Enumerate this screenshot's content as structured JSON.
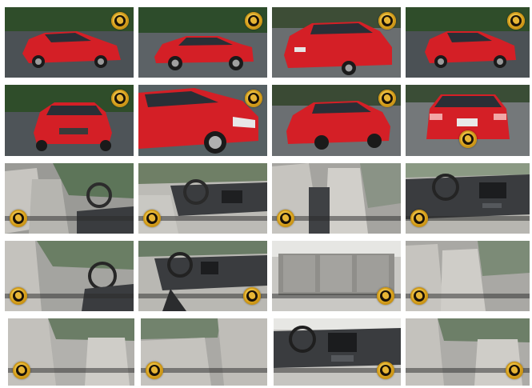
{
  "gallery": {
    "tiles": [
      {
        "view": "exterior-front-three-quarter",
        "watermark_position": "top-right"
      },
      {
        "view": "exterior-side",
        "watermark_position": "top-right"
      },
      {
        "view": "exterior-rear-three-quarter",
        "watermark_position": "top-right"
      },
      {
        "view": "exterior-front-three-quarter",
        "watermark_position": "top-right"
      },
      {
        "view": "exterior-front",
        "watermark_position": "top-right"
      },
      {
        "view": "exterior-side-closeup",
        "watermark_position": "top-right"
      },
      {
        "view": "exterior-rear-three-quarter",
        "watermark_position": "top-right"
      },
      {
        "view": "exterior-rear",
        "watermark_position": "bottom-center"
      },
      {
        "view": "interior-front-seats-driver-door",
        "watermark_position": "bottom-left"
      },
      {
        "view": "interior-dashboard-steering",
        "watermark_position": "bottom-left"
      },
      {
        "view": "interior-front-seats-passenger",
        "watermark_position": "bottom-left"
      },
      {
        "view": "interior-dashboard-center-console",
        "watermark_position": "bottom-left"
      },
      {
        "view": "interior-front-seat-steering",
        "watermark_position": "bottom-left"
      },
      {
        "view": "interior-dashboard-gear-shift",
        "watermark_position": "bottom-right"
      },
      {
        "view": "interior-rear-seats",
        "watermark_position": "bottom-right"
      },
      {
        "view": "interior-front-seats-window",
        "watermark_position": "bottom-left"
      },
      {
        "view": "interior-rear-seat-door",
        "watermark_position": "bottom-left"
      },
      {
        "view": "interior-rear-seat-legroom",
        "watermark_position": "bottom-left"
      },
      {
        "view": "interior-dashboard-rear-view",
        "watermark_position": "bottom-right"
      },
      {
        "view": "interior-rear-seats-side",
        "watermark_position": "bottom-right"
      }
    ]
  },
  "colors": {
    "car_body": "#d41f26",
    "interior": "#bdbcb8",
    "dashboard": "#3a3c3f",
    "watermark_gold": "#d9a21d"
  },
  "watermark": {
    "icon": "gold-emblem-icon"
  }
}
